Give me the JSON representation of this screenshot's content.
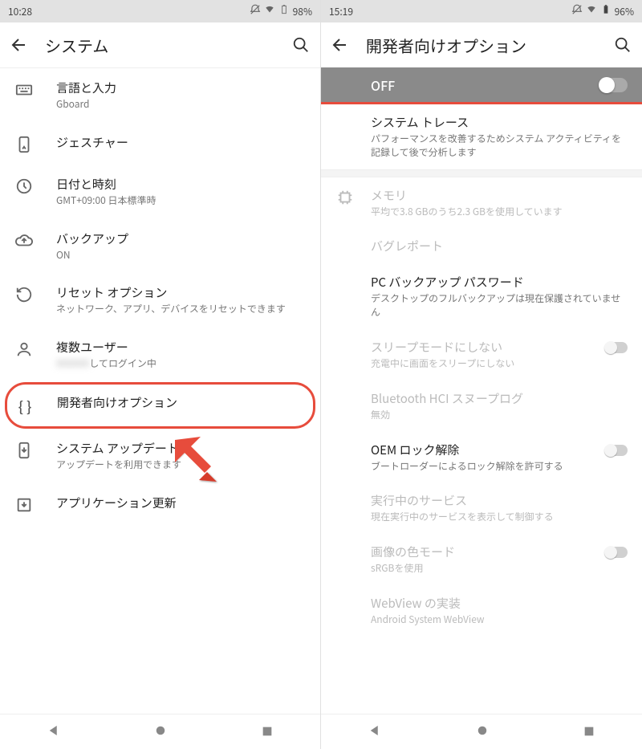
{
  "left": {
    "status": {
      "time": "10:28",
      "battery": "98%"
    },
    "title": "システム",
    "items": [
      {
        "title": "言語と入力",
        "sub": "Gboard"
      },
      {
        "title": "ジェスチャー",
        "sub": ""
      },
      {
        "title": "日付と時刻",
        "sub": "GMT+09:00 日本標準時"
      },
      {
        "title": "バックアップ",
        "sub": "ON"
      },
      {
        "title": "リセット オプション",
        "sub": "ネットワーク、アプリ、デバイスをリセットできます"
      },
      {
        "title": "複数ユーザー",
        "sub_prefix": "XXXXXX",
        "sub_suffix": "してログイン中"
      },
      {
        "title": "開発者向けオプション",
        "sub": ""
      },
      {
        "title": "システム アップデート",
        "sub": "アップデートを利用できます"
      },
      {
        "title": "アプリケーション更新",
        "sub": ""
      }
    ]
  },
  "right": {
    "status": {
      "time": "15:19",
      "battery": "96%"
    },
    "title": "開発者向けオプション",
    "master_label": "OFF",
    "items": [
      {
        "title": "システム トレース",
        "sub": "パフォーマンスを改善するためシステム アクティビティを記録して後で分析します",
        "disabled": false,
        "has_switch": false
      },
      {
        "title": "メモリ",
        "sub": "平均で3.8 GBのうち2.3 GBを使用しています",
        "disabled": true,
        "has_switch": false,
        "icon": true
      },
      {
        "title": "バグレポート",
        "sub": "",
        "disabled": true,
        "has_switch": false
      },
      {
        "title": "PC バックアップ パスワード",
        "sub": "デスクトップのフルバックアップは現在保護されていません",
        "disabled": false,
        "has_switch": false
      },
      {
        "title": "スリープモードにしない",
        "sub": "充電中に画面をスリープにしない",
        "disabled": true,
        "has_switch": true
      },
      {
        "title": "Bluetooth HCI スヌープログ",
        "sub": "無効",
        "disabled": true,
        "has_switch": false
      },
      {
        "title": "OEM ロック解除",
        "sub": "ブートローダーによるロック解除を許可する",
        "disabled": false,
        "has_switch": true
      },
      {
        "title": "実行中のサービス",
        "sub": "現在実行中のサービスを表示して制御する",
        "disabled": true,
        "has_switch": false
      },
      {
        "title": "画像の色モード",
        "sub": "sRGBを使用",
        "disabled": true,
        "has_switch": true
      },
      {
        "title": "WebView の実装",
        "sub": "Android System WebView",
        "disabled": true,
        "has_switch": false
      }
    ]
  }
}
